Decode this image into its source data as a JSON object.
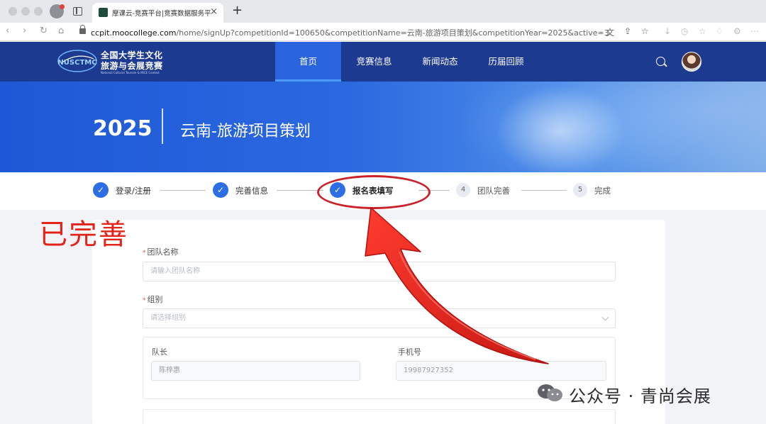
{
  "browser": {
    "tab_title": "摩课云-竞赛平台|竞赛数据服务平",
    "tab_close": "×",
    "new_tab": "+",
    "url_host": "ccpit.moocollege.com",
    "url_path": "/home/signUp?competitionId=100650&competitionName=云南-旅游项目策划&competitionYear=2025&active=3"
  },
  "site": {
    "logo_mark": "NUSCTMC",
    "logo_line1": "全国大学生文化",
    "logo_line2": "旅游与会展竞赛",
    "logo_line3": "National Cultural Tourism & MICE Contest",
    "nav": [
      {
        "label": "首页",
        "active": true
      },
      {
        "label": "竞赛信息",
        "active": false
      },
      {
        "label": "新闻动态",
        "active": false
      },
      {
        "label": "历届回顾",
        "active": false
      }
    ]
  },
  "banner": {
    "year": "2025",
    "title": "云南-旅游项目策划"
  },
  "steps": [
    {
      "label": "登录/注册",
      "status": "done",
      "marker": "✓"
    },
    {
      "label": "完善信息",
      "status": "done",
      "marker": "✓"
    },
    {
      "label": "报名表填写",
      "status": "current",
      "marker": "✓"
    },
    {
      "label": "团队完善",
      "status": "pending",
      "marker": "4"
    },
    {
      "label": "完成",
      "status": "pending",
      "marker": "5"
    }
  ],
  "annotation": {
    "note": "已完善",
    "arrow_color": "#e3241b"
  },
  "form": {
    "team_name_label": "团队名称",
    "team_name_placeholder": "请输入团队名称",
    "group_label": "组别",
    "group_placeholder": "请选择组别",
    "leader_label": "队长",
    "leader_value": "陈梓惠",
    "phone_label": "手机号",
    "phone_value": "19987927352",
    "required_mark": "*"
  },
  "watermark": {
    "text": "公众号 · 青尚会展"
  },
  "colors": {
    "header": "#1c3a8f",
    "nav_active": "#2a63de",
    "step_done": "#2d6ee6",
    "annotation": "#e3241b"
  }
}
